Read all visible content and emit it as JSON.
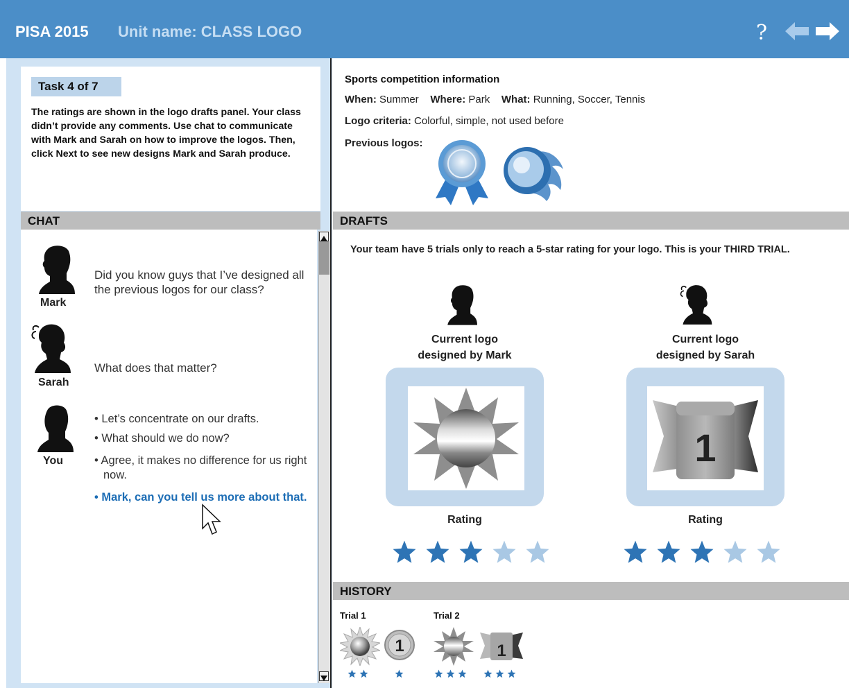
{
  "header": {
    "title": "PISA 2015",
    "unit": "Unit name: CLASS LOGO",
    "help_icon": "help-icon",
    "back_icon": "arrow-left-icon",
    "next_icon": "arrow-right-icon",
    "color": "#4b8ec8"
  },
  "task": {
    "label": "Task 4 of 7",
    "text": "The ratings are shown in the logo drafts panel. Your class didn’t provide any comments. Use chat to communicate with Mark and Sarah on how to improve the logos. Then, click Next to see new designs Mark and Sarah produce."
  },
  "chat": {
    "title": "CHAT",
    "messages": [
      {
        "name": "Mark",
        "text": "Did you know guys that I’ve designed all the previous logos for our class?"
      },
      {
        "name": "Sarah",
        "text": "What does that matter?"
      }
    ],
    "you": {
      "name": "You",
      "options": [
        "• Let’s concentrate on our drafts.",
        "• What should we do now?",
        "• Agree, it makes no difference for us right now.",
        "• Mark, can you tell us more about that."
      ]
    }
  },
  "info": {
    "heading": "Sports competition information",
    "when_label": "When:",
    "when": "Summer",
    "where_label": "Where:",
    "where": "Park",
    "what_label": "What:",
    "what": "Running, Soccer, Tennis",
    "criteria_label": "Logo criteria:",
    "criteria": "Colorful, simple, not used before",
    "previous_label": "Previous logos:"
  },
  "drafts": {
    "title": "DRAFTS",
    "intro": "Your team have 5 trials only to reach a 5-star rating for your logo. This is your THIRD TRIAL.",
    "mark_caption_1": "Current logo",
    "mark_caption_2": "designed by Mark",
    "sarah_caption_1": "Current logo",
    "sarah_caption_2": "designed by Sarah",
    "rating_label": "Rating",
    "mark_rating": 3,
    "sarah_rating": 3,
    "max_rating": 5,
    "sarah_logo_number": "1",
    "star_color": "#2e74b5",
    "star_empty_color": "#a9c8e4"
  },
  "history": {
    "title": "HISTORY",
    "trials": [
      {
        "label": "Trial 1",
        "mark_stars": 2,
        "sarah_stars": 1,
        "sarah_number": "1"
      },
      {
        "label": "Trial 2",
        "mark_stars": 3,
        "sarah_stars": 3,
        "sarah_number": "1"
      }
    ]
  }
}
